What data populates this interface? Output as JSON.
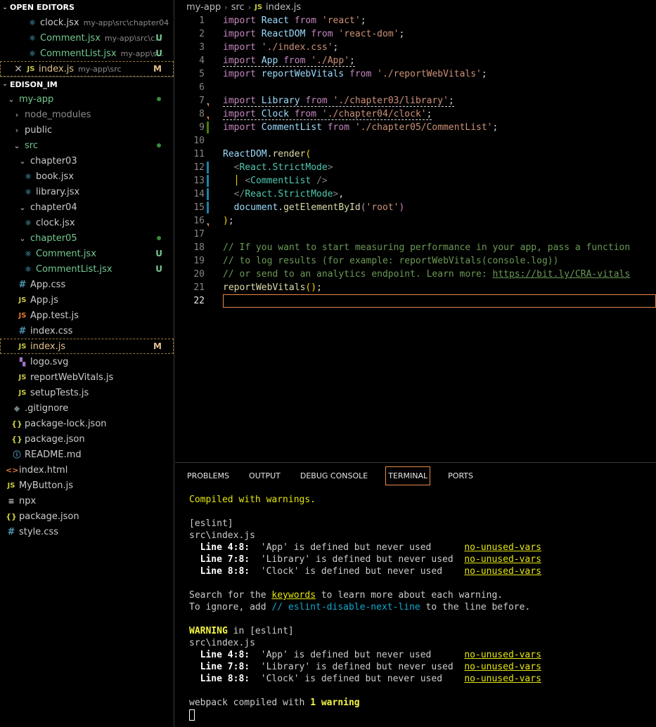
{
  "explorer": {
    "open_editors_title": "OPEN EDITORS",
    "open_editors": [
      {
        "name": "clock.jsx",
        "path": "my-app\\src\\chapter04",
        "badge": ""
      },
      {
        "name": "Comment.jsx",
        "path": "my-app\\src\\c...",
        "badge": "U"
      },
      {
        "name": "CommentList.jsx",
        "path": "my-app\\s...",
        "badge": "U"
      },
      {
        "name": "index.js",
        "path": "my-app\\src",
        "badge": "M",
        "close": "×"
      }
    ],
    "workspace_title": "EDISON_IM",
    "tree": [
      {
        "name": "my-app",
        "badge": ""
      },
      {
        "name": "node_modules",
        "badge": ""
      },
      {
        "name": "public",
        "badge": ""
      },
      {
        "name": "src",
        "badge": ""
      },
      {
        "name": "chapter03",
        "badge": ""
      },
      {
        "name": "book.jsx",
        "badge": ""
      },
      {
        "name": "library.jsx",
        "badge": ""
      },
      {
        "name": "chapter04",
        "badge": ""
      },
      {
        "name": "clock.jsx",
        "badge": ""
      },
      {
        "name": "chapter05",
        "badge": ""
      },
      {
        "name": "Comment.jsx",
        "badge": "U"
      },
      {
        "name": "CommentList.jsx",
        "badge": "U"
      },
      {
        "name": "App.css",
        "badge": ""
      },
      {
        "name": "App.js",
        "badge": ""
      },
      {
        "name": "App.test.js",
        "badge": ""
      },
      {
        "name": "index.css",
        "badge": ""
      },
      {
        "name": "index.js",
        "badge": "M"
      },
      {
        "name": "logo.svg",
        "badge": ""
      },
      {
        "name": "reportWebVitals.js",
        "badge": ""
      },
      {
        "name": "setupTests.js",
        "badge": ""
      },
      {
        "name": ".gitignore",
        "badge": ""
      },
      {
        "name": "package-lock.json",
        "badge": ""
      },
      {
        "name": "package.json",
        "badge": ""
      },
      {
        "name": "README.md",
        "badge": ""
      },
      {
        "name": "index.html",
        "badge": ""
      },
      {
        "name": "MyButton.js",
        "badge": ""
      },
      {
        "name": "npx",
        "badge": ""
      },
      {
        "name": "package.json",
        "badge": ""
      },
      {
        "name": "style.css",
        "badge": ""
      }
    ]
  },
  "breadcrumb": {
    "parts": [
      "my-app",
      "src"
    ],
    "file_icon": "JS",
    "file": "index.js"
  },
  "editor": {
    "line_numbers": [
      "1",
      "2",
      "3",
      "4",
      "5",
      "6",
      "7",
      "8",
      "9",
      "10",
      "11",
      "12",
      "13",
      "14",
      "15",
      "16",
      "17",
      "18",
      "19",
      "20",
      "21",
      "22"
    ],
    "current_line": "22"
  },
  "panel": {
    "tabs": [
      "PROBLEMS",
      "OUTPUT",
      "DEBUG CONSOLE",
      "TERMINAL",
      "PORTS"
    ],
    "active_tab": "TERMINAL",
    "terminal": {
      "compiled": "Compiled with warnings.",
      "eslint": "[eslint]",
      "file": "src\\index.js",
      "warnings": [
        {
          "pos": "  Line 4:8:  ",
          "msg": "'App' is defined but never used      ",
          "rule": "no-unused-vars"
        },
        {
          "pos": "  Line 7:8:  ",
          "msg": "'Library' is defined but never used  ",
          "rule": "no-unused-vars"
        },
        {
          "pos": "  Line 8:8:  ",
          "msg": "'Clock' is defined but never used    ",
          "rule": "no-unused-vars"
        }
      ],
      "search_pre": "Search for the ",
      "search_kw": "keywords",
      "search_post": " to learn more about each warning.",
      "ignore_pre": "To ignore, add ",
      "ignore_kw": "// eslint-disable-next-line",
      "ignore_post": " to the line before.",
      "warning_word": "WARNING",
      "warning_in": " in [eslint]",
      "webpack_pre": "webpack compiled with ",
      "webpack_count": "1 warning"
    }
  }
}
